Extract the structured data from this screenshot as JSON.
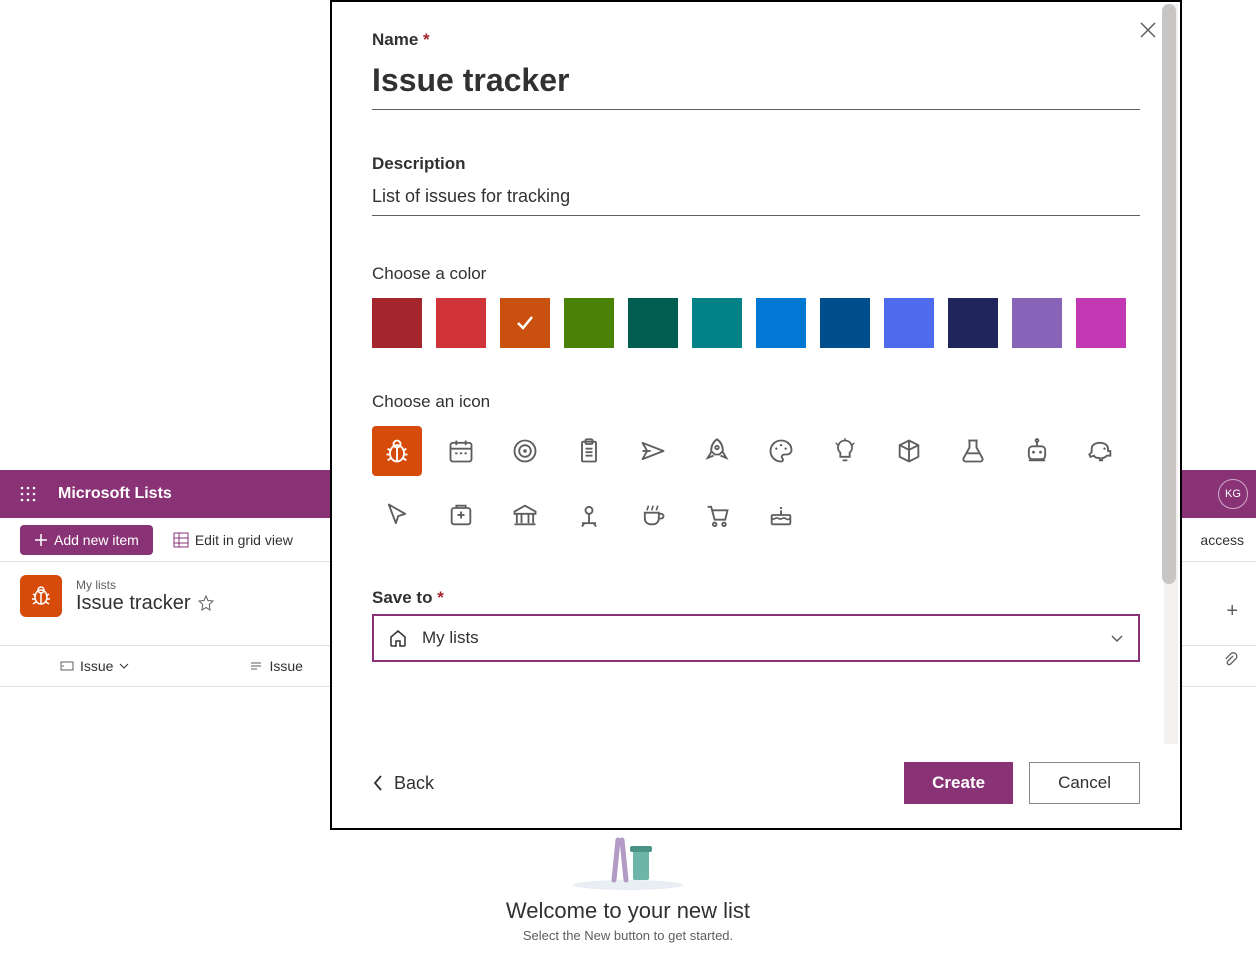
{
  "app": {
    "title": "Microsoft Lists",
    "avatar_initials": "KG"
  },
  "toolbar": {
    "add_label": "Add new item",
    "edit_grid_label": "Edit in grid view",
    "access_text": "access"
  },
  "list_header": {
    "breadcrumb": "My lists",
    "title": "Issue tracker"
  },
  "columns": {
    "col1": "Issue",
    "col2": "Issue"
  },
  "welcome": {
    "heading": "Welcome to your new list",
    "subtext": "Select the New button to get started."
  },
  "modal": {
    "name_label": "Name",
    "name_value": "Issue tracker",
    "desc_label": "Description",
    "desc_value": "List of issues for tracking",
    "color_label": "Choose a color",
    "icon_label": "Choose an icon",
    "save_label": "Save to",
    "save_value": "My lists",
    "back": "Back",
    "create": "Create",
    "cancel": "Cancel",
    "colors": [
      "#a4262c",
      "#d13438",
      "#ca5010",
      "#498205",
      "#005e50",
      "#038387",
      "#0078d4",
      "#004e8c",
      "#4f6bed",
      "#20255b",
      "#8764b8",
      "#c239b3"
    ],
    "selected_color_index": 2,
    "selected_icon_index": 0
  }
}
